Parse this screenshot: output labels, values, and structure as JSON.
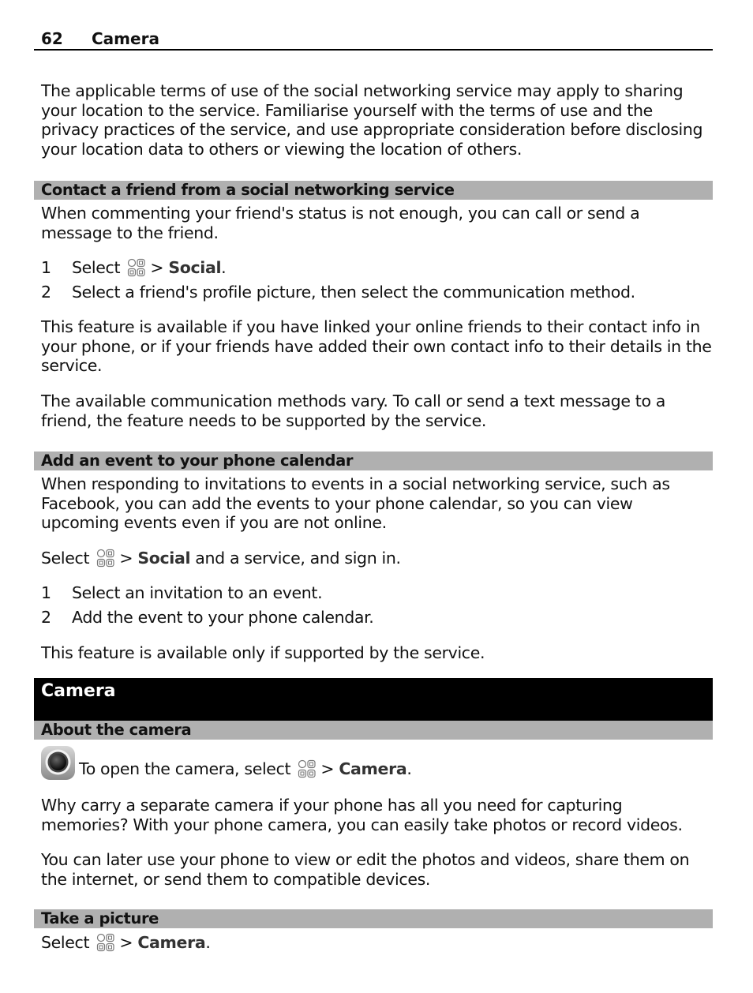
{
  "header": {
    "page_number": "62",
    "section": "Camera"
  },
  "intro_paragraph": "The applicable terms of use of the social networking service may apply to sharing your location to the service. Familiarise yourself with the terms of use and the privacy practices of the service, and use appropriate consideration before disclosing your location data to others or viewing the location of others.",
  "contact_section": {
    "heading": "Contact a friend from a social networking service",
    "intro": "When commenting your friend's status is not enough, you can call or send a message to the friend.",
    "steps": [
      {
        "num": "1",
        "prefix": "Select",
        "arrow": ">",
        "bold": "Social",
        "suffix": "."
      },
      {
        "num": "2",
        "text": "Select a friend's profile picture, then select the communication method."
      }
    ],
    "para1": "This feature is available if you have linked your online friends to their contact info in your phone, or if your friends have added their own contact info to their details in the service.",
    "para2": "The available communication methods vary. To call or send a text message to a friend, the feature needs to be supported by the service."
  },
  "event_section": {
    "heading": "Add an event to your phone calendar",
    "intro": "When responding to invitations to events in a social networking service, such as Facebook, you can add the events to your phone calendar, so you can view upcoming events even if you are not online.",
    "select_line": {
      "prefix": "Select",
      "arrow": ">",
      "bold": "Social",
      "suffix": "and a service, and sign in."
    },
    "steps": [
      {
        "num": "1",
        "text": "Select an invitation to an event."
      },
      {
        "num": "2",
        "text": "Add the event to your phone calendar."
      }
    ],
    "note": "This feature is available only if supported by the service."
  },
  "chapter": {
    "title": "Camera"
  },
  "about_section": {
    "heading": "About the camera",
    "open_line": {
      "prefix": "To open the camera, select",
      "arrow": ">",
      "bold": "Camera",
      "suffix": "."
    },
    "para1": "Why carry a separate camera if your phone has all you need for capturing memories? With your phone camera, you can easily take photos or record videos.",
    "para2": "You can later use your phone to view or edit the photos and videos, share them on the internet, or send them to compatible devices."
  },
  "picture_section": {
    "heading": "Take a picture",
    "select_line": {
      "prefix": "Select",
      "arrow": ">",
      "bold": "Camera",
      "suffix": "."
    }
  },
  "icons": {
    "menu": "menu-grid-icon",
    "camera": "camera-app-icon"
  },
  "colors": {
    "section_bar": "#b0b0b0",
    "chapter_bar": "#000000",
    "text": "#111111"
  }
}
